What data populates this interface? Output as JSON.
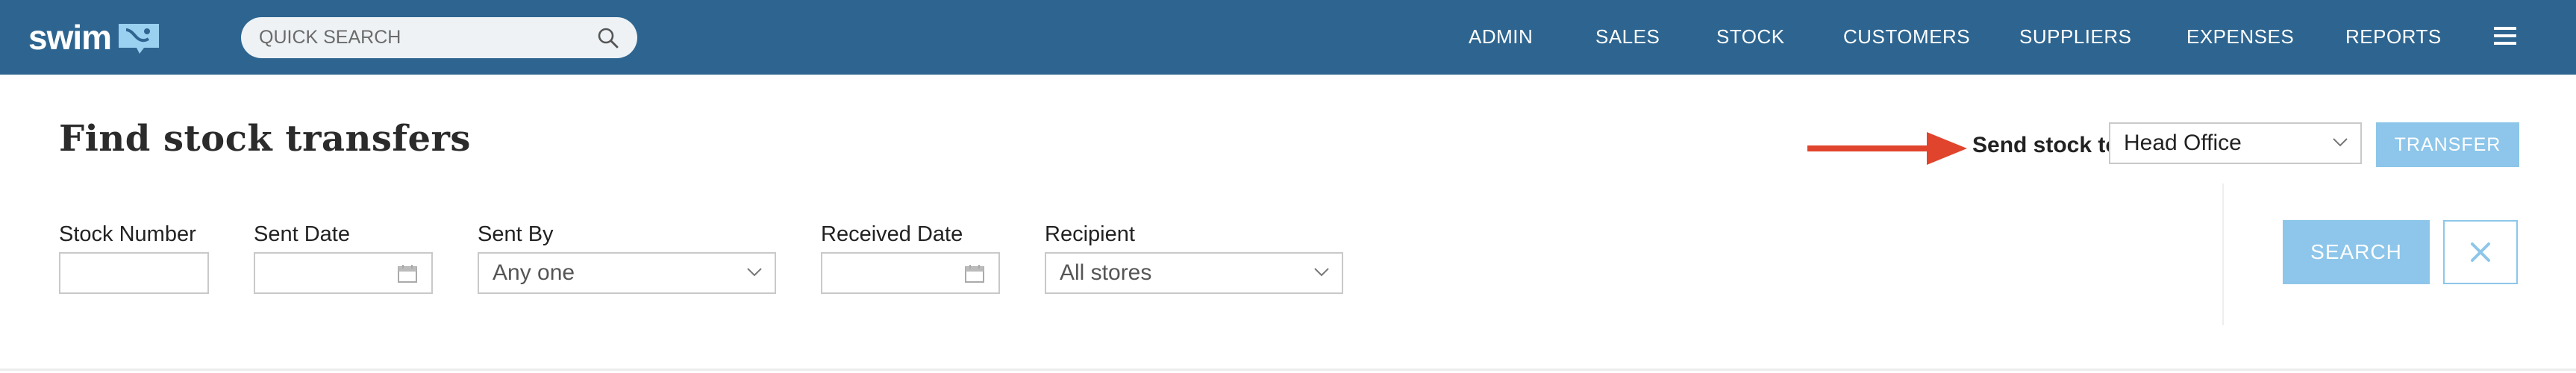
{
  "brand": {
    "name": "swim"
  },
  "search": {
    "placeholder": "QUICK SEARCH"
  },
  "nav": {
    "items": [
      {
        "label": "ADMIN"
      },
      {
        "label": "SALES"
      },
      {
        "label": "STOCK"
      },
      {
        "label": "CUSTOMERS"
      },
      {
        "label": "SUPPLIERS"
      },
      {
        "label": "EXPENSES"
      },
      {
        "label": "REPORTS"
      }
    ]
  },
  "page": {
    "title": "Find stock transfers"
  },
  "transfer": {
    "send_label": "Send stock to:",
    "destination": "Head Office",
    "button_label": "TRANSFER"
  },
  "filters": {
    "stock_number": {
      "label": "Stock Number",
      "value": ""
    },
    "sent_date": {
      "label": "Sent Date",
      "value": ""
    },
    "sent_by": {
      "label": "Sent By",
      "value": "Any one"
    },
    "received_date": {
      "label": "Received Date",
      "value": ""
    },
    "recipient": {
      "label": "Recipient",
      "value": "All stores"
    }
  },
  "actions": {
    "search_label": "SEARCH"
  },
  "colors": {
    "topbar": "#2e6590",
    "button_primary": "#8dc6ea",
    "arrow": "#e0442c"
  }
}
